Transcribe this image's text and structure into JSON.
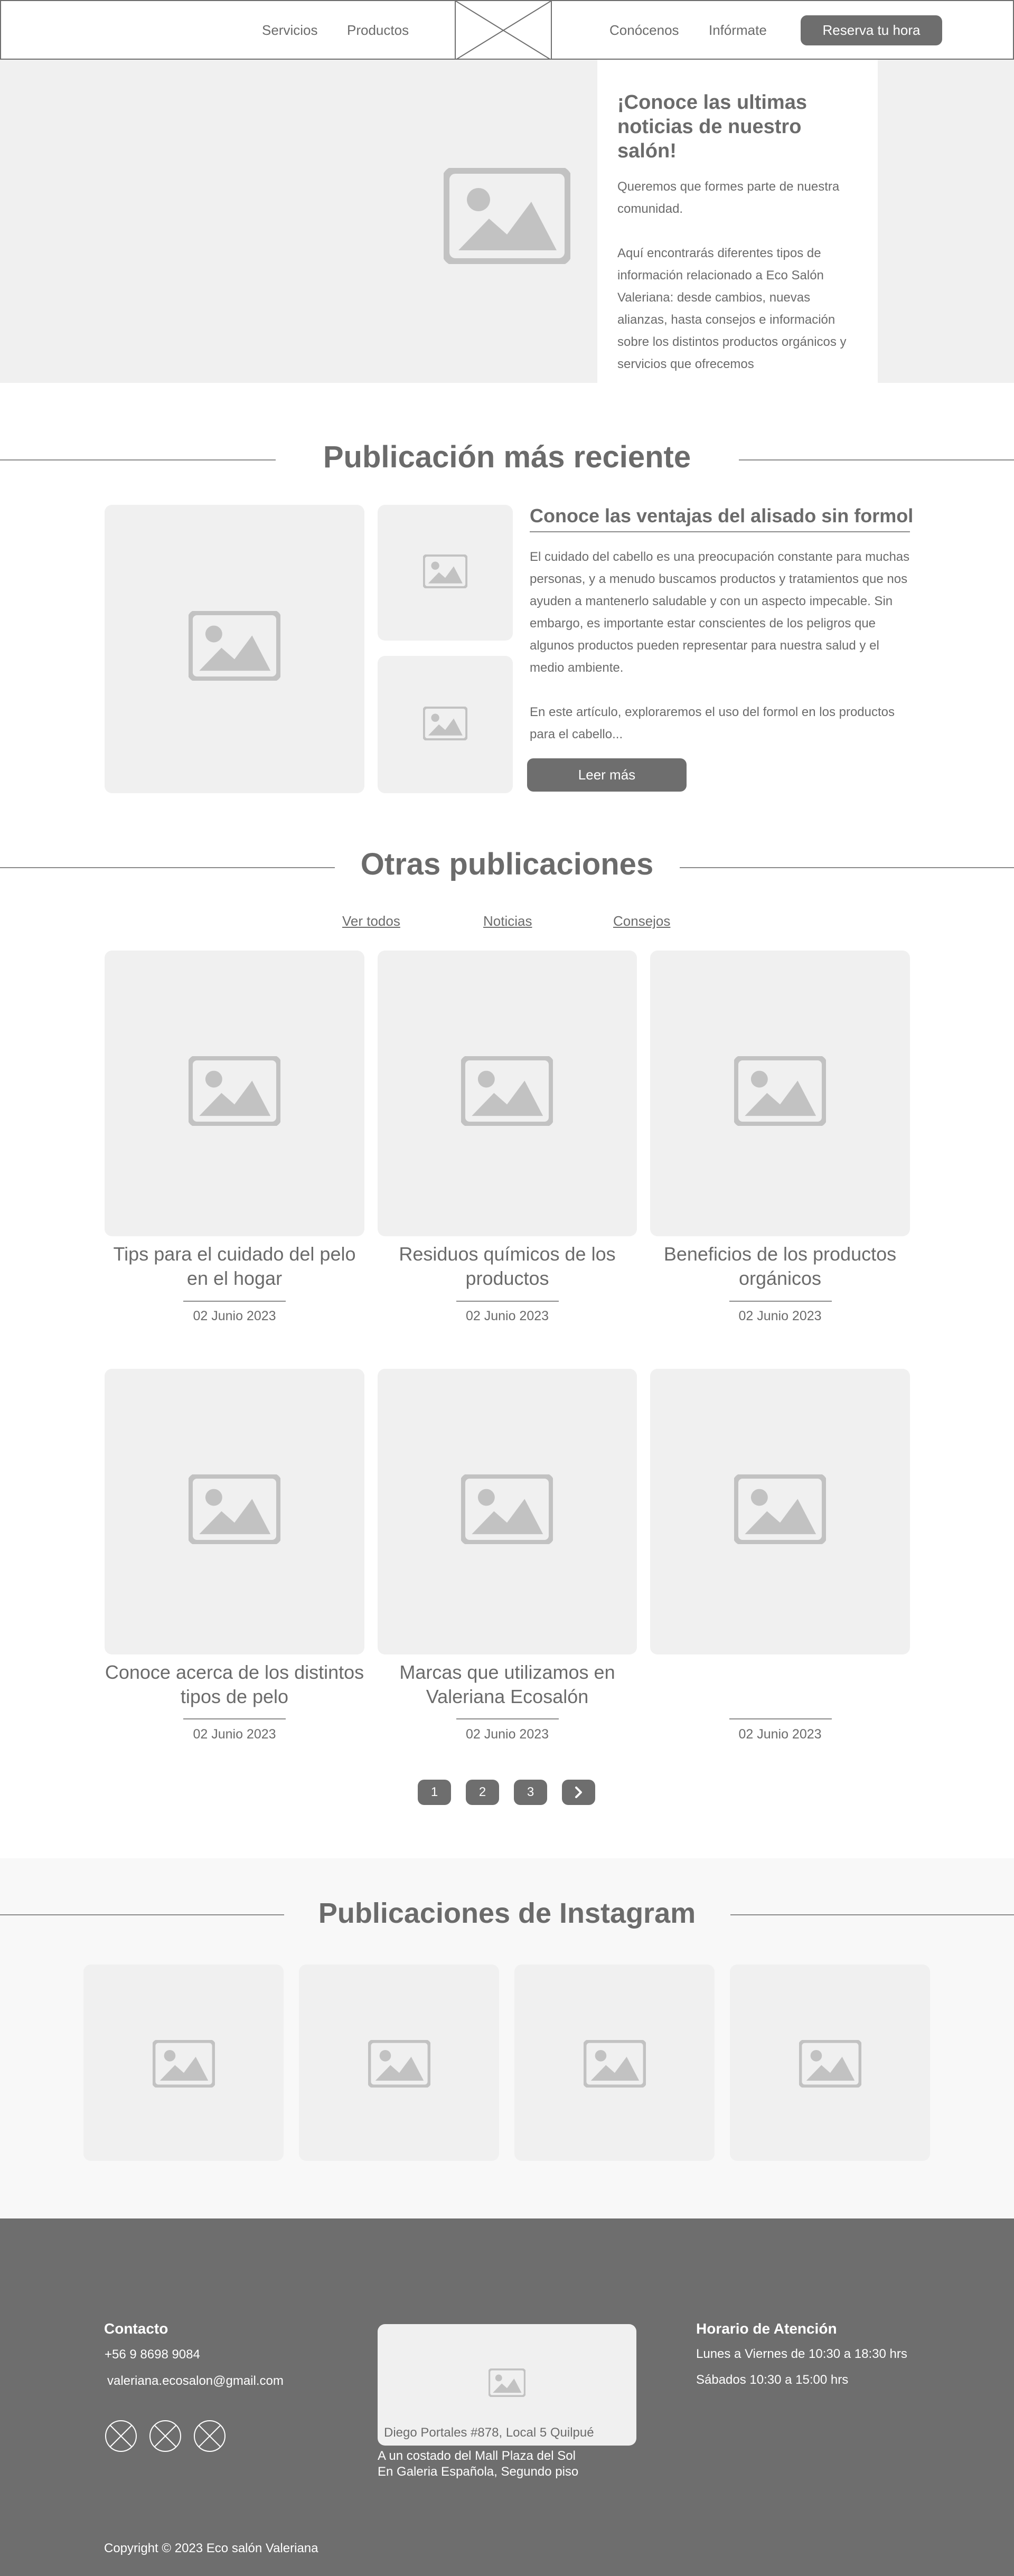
{
  "header": {
    "nav_left": [
      "Servicios",
      "Productos"
    ],
    "nav_right": [
      "Conócenos",
      "Infórmate"
    ],
    "reserve_label": "Reserva tu hora"
  },
  "hero": {
    "title": "¡Conoce las ultimas noticias de nuestro salón!",
    "intro": "Queremos que formes parte de nuestra comunidad.",
    "body": "Aquí encontrarás diferentes tipos de información relacionado a Eco Salón Valeriana: desde cambios, nuevas alianzas, hasta consejos e información sobre los distintos productos orgánicos y servicios que ofrecemos"
  },
  "latest": {
    "section_title": "Publicación más reciente",
    "article_title": "Conoce las ventajas del alisado sin formol",
    "paragraph_1": "El cuidado del cabello es una preocupación constante para muchas personas, y a menudo buscamos productos y tratamientos que nos ayuden a mantenerlo saludable y con un aspecto impecable. Sin embargo, es importante estar conscientes de los peligros que algunos productos pueden representar para nuestra salud y el medio ambiente.",
    "paragraph_2": "En este artículo, exploraremos el uso del formol en los productos para el cabello...",
    "read_more": "Leer más"
  },
  "others": {
    "section_title": "Otras publicaciones",
    "filters": [
      "Ver todos",
      "Noticias",
      "Consejos"
    ],
    "posts": [
      {
        "title": "Tips para el cuidado del pelo en el hogar",
        "date": "02 Junio 2023"
      },
      {
        "title": "Residuos químicos de los productos",
        "date": "02 Junio 2023"
      },
      {
        "title": "Beneficios de los productos orgánicos",
        "date": "02 Junio 2023"
      },
      {
        "title": "Conoce acerca de los distintos tipos de pelo",
        "date": "02 Junio 2023"
      },
      {
        "title": "Marcas que utilizamos en Valeriana Ecosalón",
        "date": "02 Junio 2023"
      },
      {
        "title": "",
        "date": "02 Junio 2023"
      }
    ],
    "pagination": [
      "1",
      "2",
      "3"
    ]
  },
  "instagram": {
    "section_title": "Publicaciones de Instagram"
  },
  "footer": {
    "contact_heading": "Contacto",
    "phone": "+56 9 8698 9084",
    "email": "valeriana.ecosalon@gmail.com",
    "map_address": "Diego Portales #878, Local 5 Quilpué",
    "location_line_1": "A un costado del Mall Plaza del Sol",
    "location_line_2": "En Galeria Española, Segundo piso",
    "hours_heading": "Horario de Atención",
    "hours_weekdays": "Lunes a Viernes de 10:30 a 18:30 hrs",
    "hours_saturday": "Sábados 10:30 a 15:00 hrs",
    "copyright": "Copyright © 2023 Eco salón Valeriana"
  },
  "colors": {
    "accent": "#6e6e6e",
    "placeholder_bg": "#f0f0f0",
    "placeholder_icon": "#c2c2c2"
  }
}
